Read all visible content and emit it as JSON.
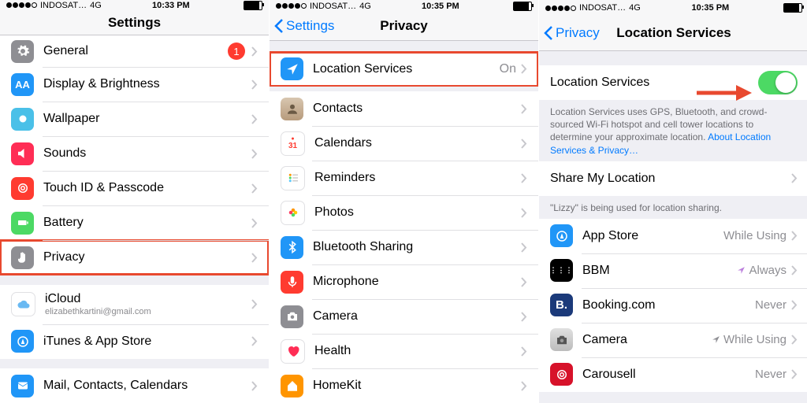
{
  "status": {
    "carrier": "INDOSAT…",
    "net": "4G",
    "time1": "10:33 PM",
    "time2": "10:35 PM",
    "time3": "10:35 PM"
  },
  "p1": {
    "title": "Settings",
    "items": [
      {
        "label": "General"
      },
      {
        "label": "Display & Brightness"
      },
      {
        "label": "Wallpaper"
      },
      {
        "label": "Sounds"
      },
      {
        "label": "Touch ID & Passcode"
      },
      {
        "label": "Battery"
      },
      {
        "label": "Privacy"
      }
    ],
    "icloud": {
      "label": "iCloud",
      "sub": "elizabethkartini@gmail.com"
    },
    "itunes": {
      "label": "iTunes & App Store"
    },
    "mail": {
      "label": "Mail, Contacts, Calendars"
    }
  },
  "p2": {
    "back": "Settings",
    "title": "Privacy",
    "loc": {
      "label": "Location Services",
      "val": "On"
    },
    "items": [
      {
        "label": "Contacts"
      },
      {
        "label": "Calendars"
      },
      {
        "label": "Reminders"
      },
      {
        "label": "Photos"
      },
      {
        "label": "Bluetooth Sharing"
      },
      {
        "label": "Microphone"
      },
      {
        "label": "Camera"
      },
      {
        "label": "Health"
      },
      {
        "label": "HomeKit"
      }
    ]
  },
  "p3": {
    "back": "Privacy",
    "title": "Location Services",
    "toggle": {
      "label": "Location Services"
    },
    "desc": "Location Services uses GPS, Bluetooth, and crowd-sourced Wi-Fi hotspot and cell tower locations to determine your approximate location. ",
    "descLink": "About Location Services & Privacy…",
    "share": {
      "label": "Share My Location"
    },
    "shareFooter": "\"Lizzy\" is being used for location sharing.",
    "apps": [
      {
        "label": "App Store",
        "val": "While Using",
        "loc": false
      },
      {
        "label": "BBM",
        "val": "Always",
        "loc": true,
        "active": true
      },
      {
        "label": "Booking.com",
        "val": "Never",
        "loc": false
      },
      {
        "label": "Camera",
        "val": "While Using",
        "loc": true
      },
      {
        "label": "Carousell",
        "val": "Never",
        "loc": false
      }
    ]
  }
}
